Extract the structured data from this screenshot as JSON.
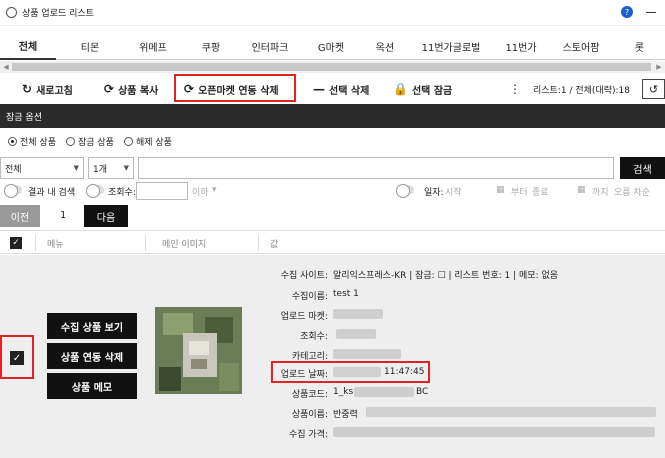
{
  "window": {
    "title": "상품 업로드 리스트",
    "help_badge": "?"
  },
  "tabs": [
    {
      "label": "전체",
      "active": true
    },
    {
      "label": "티몬"
    },
    {
      "label": "위메프"
    },
    {
      "label": "쿠팡"
    },
    {
      "label": "인터파크"
    },
    {
      "label": "G마켓"
    },
    {
      "label": "옥션"
    },
    {
      "label": "11번가글로벌"
    },
    {
      "label": "11번가"
    },
    {
      "label": "스토어팜"
    },
    {
      "label": "롯"
    }
  ],
  "toolbar": {
    "refresh": "새로고침",
    "copy": "상품 복사",
    "openmarket_delete": "오픈마켓 연동 삭제",
    "selected_delete": "선택 삭제",
    "selected_lock": "선택 잠금",
    "status": "리스트:1  /  전체(대략):18"
  },
  "lock_options": {
    "title": "잠금 옵션"
  },
  "radios": [
    {
      "label": "전체 상품",
      "checked": true
    },
    {
      "label": "잠금 상품",
      "checked": false
    },
    {
      "label": "해제 상품",
      "checked": false
    }
  ],
  "search": {
    "scope_select": "전체",
    "count_select": "1개",
    "query": "",
    "button": "검색"
  },
  "filters": {
    "in_result": "결과 내 검색",
    "views_label": "조회수:",
    "views_suffix": "이하",
    "date_label": "일자:",
    "date_start": "시작",
    "date_from": "부터",
    "date_end": "종료",
    "date_until": "까지",
    "sort": "오름 차순"
  },
  "pager": {
    "prev": "이전",
    "page": "1",
    "next": "다음"
  },
  "grid": {
    "headers": [
      "메뉴",
      "메인 이미지",
      "값"
    ],
    "row": {
      "checked": true,
      "buttons": [
        "수집 상품 보기",
        "상품 연동 삭제",
        "상품 메모"
      ],
      "fields": [
        {
          "label": "수집 사이트:",
          "value": "알리익스프레스-KR  |  잠금:  ☐  |  리스트 번호:  1  |  메모:  없음"
        },
        {
          "label": "수집이름:",
          "value": "test 1"
        },
        {
          "label": "업로드 마켓:",
          "value": ""
        },
        {
          "label": "조회수:",
          "value": ""
        },
        {
          "label": "카테고리:",
          "value": ""
        },
        {
          "label": "업로드 날짜:",
          "value": "11:47:45"
        },
        {
          "label": "상품코드:",
          "value": "1_ks"
        },
        {
          "label": "상품이름:",
          "value": "반중력"
        },
        {
          "label": "수집 가격:",
          "value": ""
        }
      ],
      "code_suffix": "BC"
    }
  },
  "colors": {
    "highlight": "#e02424",
    "dark": "#2b2b2b",
    "row_bg": "#eeeeee"
  }
}
